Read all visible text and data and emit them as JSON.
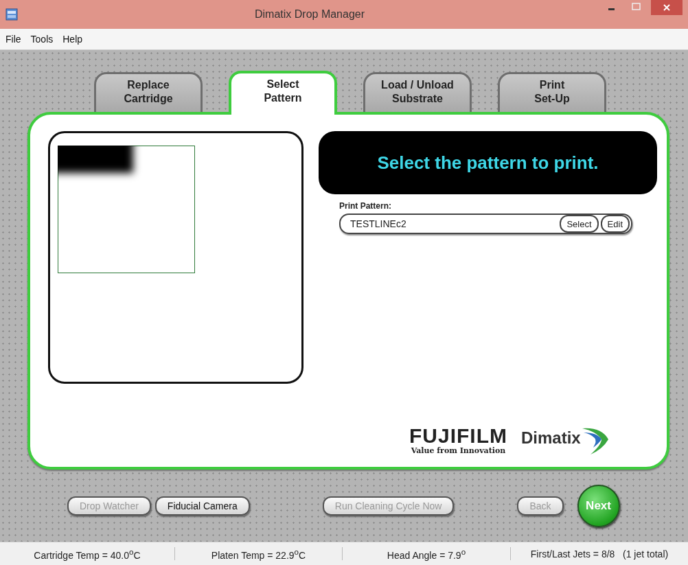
{
  "window": {
    "title": "Dimatix Drop Manager"
  },
  "menu": [
    "File",
    "Tools",
    "Help"
  ],
  "tabs": [
    {
      "label": "Replace\nCartridge",
      "selected": false
    },
    {
      "label": "Select\nPattern",
      "selected": true
    },
    {
      "label": "Load / Unload\nSubstrate",
      "selected": false
    },
    {
      "label": "Print\nSet-Up",
      "selected": false
    }
  ],
  "banner": "Select the pattern to print.",
  "print_pattern": {
    "label": "Print Pattern:",
    "value": "TESTLINEc2",
    "buttons": [
      "Select",
      "Edit"
    ]
  },
  "logo": {
    "brand": "FUJIFILM",
    "tagline": "Value from Innovation",
    "product": "Dimatix"
  },
  "buttons": [
    {
      "label": "Drop Watcher",
      "disabled": true
    },
    {
      "label": "Fiducial Camera",
      "disabled": false
    },
    {
      "label": "Run Cleaning Cycle Now",
      "disabled": true
    },
    {
      "label": "Back",
      "disabled": true
    }
  ],
  "next": "Next",
  "status_bar": [
    "Cartridge Temp = 40.0$^{o}$C",
    "Platen Temp = 22.9$^{o}$C",
    "Head Angle = 7.9$^{o}$",
    "First/Last Jets = 8/8   (1 jet total)"
  ]
}
